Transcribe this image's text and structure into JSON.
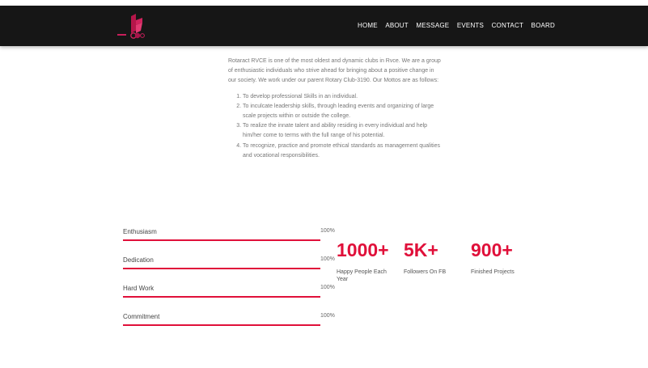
{
  "nav": {
    "items": [
      "HOME",
      "ABOUT",
      "MESSAGE",
      "EVENTS",
      "CONTACT",
      "BOARD"
    ]
  },
  "about": {
    "intro": "Rotaract RVCE is one of the most oldest and dynamic clubs in Rvce. We are a group of enthusiastic individuals who strive ahead for bringing about a positive change in our society. We work under our parent Rotary Club-3190. Our Mottos are as follows:",
    "mottos": [
      "To develop professional Skills in an individual.",
      "To inculcate leadership skills, through leading events and organizing of large scale projects within or outside the college.",
      "To realize the innate talent and ability residing in every individual and help him/her come to terms with the full range of his potential.",
      "To recognize, practice and promote ethical standards as management qualities and vocational responsibilities."
    ]
  },
  "skills": [
    {
      "label": "Enthusiasm",
      "percent_text": "100%",
      "value": 1.0
    },
    {
      "label": "Dedication",
      "percent_text": "100%",
      "value": 1.0
    },
    {
      "label": "Hard Work",
      "percent_text": "100%",
      "value": 1.0
    },
    {
      "label": "Commitment",
      "percent_text": "100%",
      "value": 1.0
    }
  ],
  "stats": [
    {
      "number": "1000+",
      "caption": "Happy People Each Year"
    },
    {
      "number": "5K+",
      "caption": "Followers On FB"
    },
    {
      "number": "900+",
      "caption": "Finished Projects"
    }
  ],
  "colors": {
    "accent": "#e0103a",
    "topbar": "#161616"
  },
  "logo": {
    "icon": "rotaract-logo"
  }
}
